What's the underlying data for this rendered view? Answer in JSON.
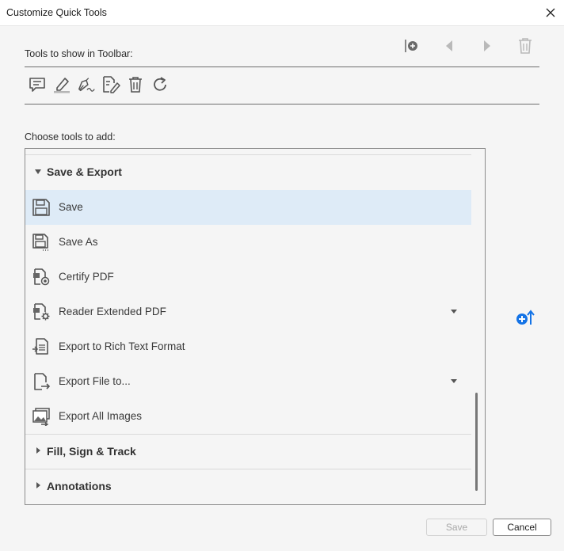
{
  "window": {
    "title": "Customize Quick Tools"
  },
  "toolbar_section": {
    "label": "Tools to show in Toolbar:"
  },
  "choose_section": {
    "label": "Choose tools to add:"
  },
  "groups": [
    {
      "label": "Save & Export",
      "expanded": true
    },
    {
      "label": "Fill, Sign & Track",
      "expanded": false
    },
    {
      "label": "Annotations",
      "expanded": false
    }
  ],
  "items": [
    {
      "label": "Save",
      "selected": true,
      "icon": "save-icon"
    },
    {
      "label": "Save As",
      "selected": false,
      "icon": "save-as-icon"
    },
    {
      "label": "Certify PDF",
      "selected": false,
      "icon": "certify-pdf-icon"
    },
    {
      "label": "Reader Extended PDF",
      "selected": false,
      "icon": "reader-extended-icon",
      "has_dropdown": true
    },
    {
      "label": "Export to Rich Text Format",
      "selected": false,
      "icon": "export-rtf-icon"
    },
    {
      "label": "Export File to...",
      "selected": false,
      "icon": "export-file-icon",
      "has_dropdown": true
    },
    {
      "label": "Export All Images",
      "selected": false,
      "icon": "export-images-icon"
    }
  ],
  "buttons": {
    "save": "Save",
    "cancel": "Cancel"
  },
  "colors": {
    "selection": "#deebf7",
    "accent": "#1473e6"
  }
}
